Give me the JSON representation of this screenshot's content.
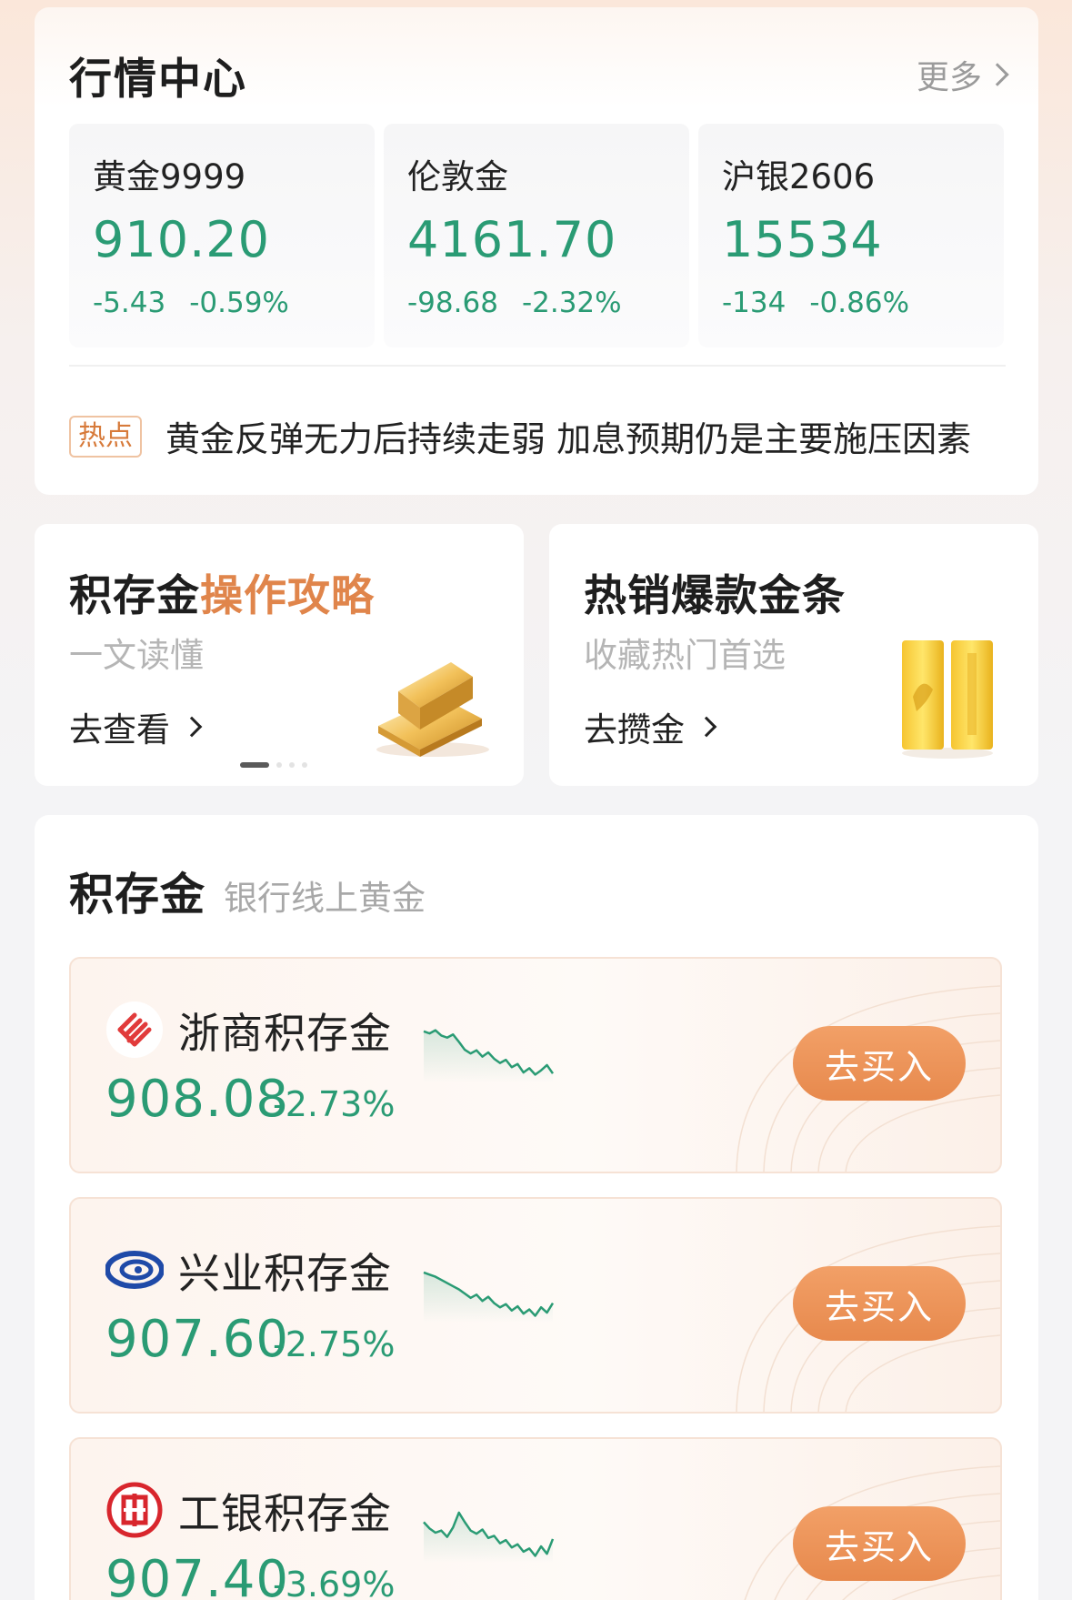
{
  "market": {
    "title": "行情中心",
    "more_label": "更多",
    "tiles": [
      {
        "name": "黄金9999",
        "price": "910.20",
        "change": "-5.43",
        "change_pct": "-0.59%"
      },
      {
        "name": "伦敦金",
        "price": "4161.70",
        "change": "-98.68",
        "change_pct": "-2.32%"
      },
      {
        "name": "沪银2606",
        "price": "15534",
        "change": "-134",
        "change_pct": "-0.86%"
      }
    ],
    "hot": {
      "badge": "热点",
      "headline": "黄金反弹无力后持续走弱 加息预期仍是主要施压因素"
    }
  },
  "promos": [
    {
      "title_plain": "积存金",
      "title_accent": "操作攻略",
      "subtitle": "一文读懂",
      "link": "去查看"
    },
    {
      "title_plain": "热销爆款金条",
      "title_accent": "",
      "subtitle": "收藏热门首选",
      "link": "去攒金"
    }
  ],
  "savings": {
    "title": "积存金",
    "subtitle": "银行线上黄金",
    "products": [
      {
        "name": "浙商积存金",
        "price": "908.08",
        "change_pct": "-2.73%",
        "button": "去买入",
        "logo_icon": "czbank-logo-icon",
        "trend": [
          0.1,
          0.14,
          0.08,
          0.18,
          0.22,
          0.16,
          0.3,
          0.45,
          0.52,
          0.46,
          0.58,
          0.5,
          0.62,
          0.7,
          0.64,
          0.78,
          0.72,
          0.88,
          0.8,
          0.92,
          0.84,
          0.74,
          0.9
        ]
      },
      {
        "name": "兴业积存金",
        "price": "907.60",
        "change_pct": "-2.75%",
        "button": "去买入",
        "logo_icon": "cib-logo-icon",
        "trend": [
          0.12,
          0.16,
          0.2,
          0.26,
          0.32,
          0.38,
          0.44,
          0.52,
          0.6,
          0.54,
          0.66,
          0.58,
          0.7,
          0.78,
          0.72,
          0.84,
          0.76,
          0.9,
          0.82,
          0.94,
          0.78,
          0.88,
          0.7
        ]
      },
      {
        "name": "工银积存金",
        "price": "907.40",
        "change_pct": "-3.69%",
        "button": "去买入",
        "logo_icon": "icbc-logo-icon",
        "trend": [
          0.3,
          0.42,
          0.5,
          0.46,
          0.58,
          0.4,
          0.12,
          0.3,
          0.46,
          0.52,
          0.44,
          0.6,
          0.56,
          0.7,
          0.64,
          0.78,
          0.72,
          0.86,
          0.8,
          0.94,
          0.76,
          0.9,
          0.62
        ]
      }
    ]
  },
  "colors": {
    "down_green": "#2a9b74",
    "accent_orange": "#e0854b",
    "button_orange": "#ec9157",
    "hot_badge": "#d77a3a"
  }
}
